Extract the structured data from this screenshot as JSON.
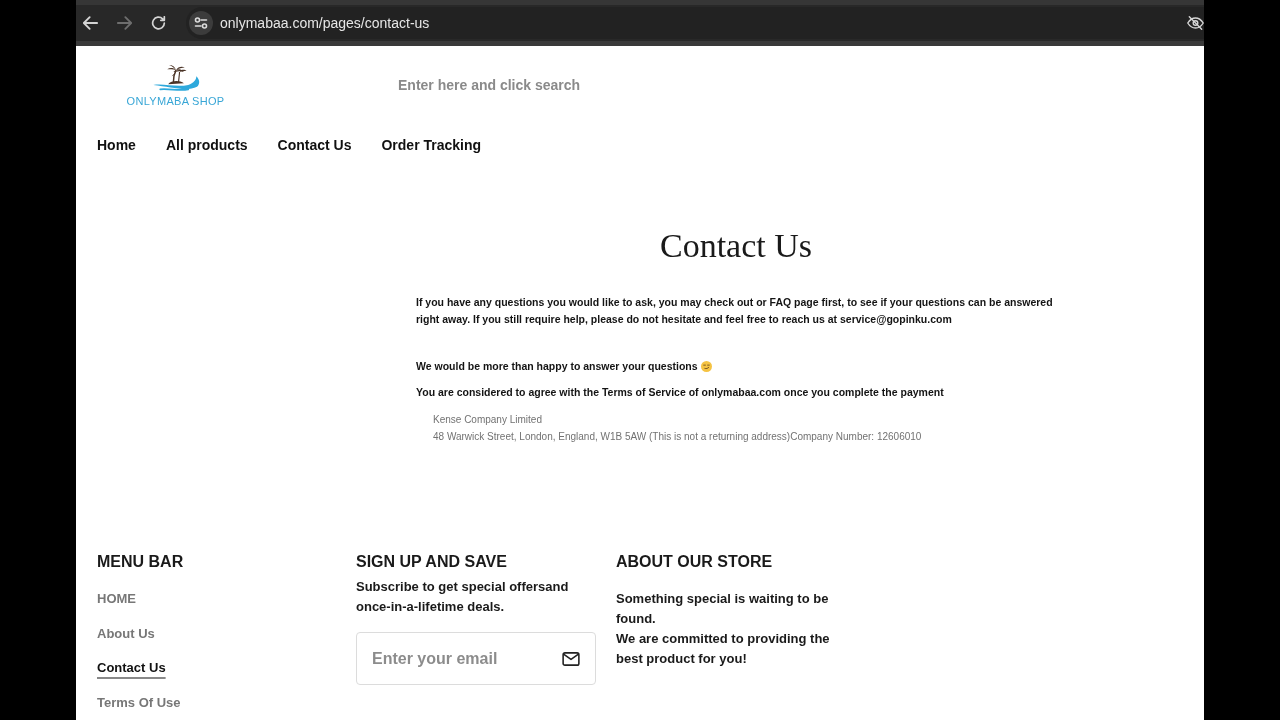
{
  "browser": {
    "nav_buttons": [
      {
        "kind": "back",
        "disabled": false
      },
      {
        "kind": "forward",
        "disabled": true
      },
      {
        "kind": "reload",
        "disabled": false
      }
    ],
    "url": "onlymabaa.com/pages/contact-us"
  },
  "header": {
    "logo_text": "ONLYMABA SHOP",
    "search": {
      "placeholder": "Enter here and click search"
    }
  },
  "nav": [
    "Home",
    "All products",
    "Contact Us",
    "Order Tracking"
  ],
  "main": {
    "title": "Contact Us",
    "intro": "If you have any questions you would like to ask, you may check out or FAQ page first, to see if your questions can be answered right away. If you still require help, please do not hesitate and feel free to reach us at service@gopinku.com",
    "happy": "We would be more than happy to answer your questions",
    "terms": "You are considered to agree with the Terms of Service of onlymabaa.com once you complete the payment",
    "address_lines": [
      "Kense Company Limited",
      "48 Warwick Street, London, England, W1B 5AW (This is not a returning address)Company Number: 12606010"
    ]
  },
  "footer": {
    "menu": {
      "heading": "MENU BAR",
      "links": [
        {
          "label": "HOME",
          "selected": false
        },
        {
          "label": "About Us",
          "selected": false
        },
        {
          "label": "Contact Us",
          "selected": true
        },
        {
          "label": "Terms Of Use",
          "selected": false
        }
      ]
    },
    "signup": {
      "heading": "SIGN UP AND SAVE",
      "text": "Subscribe to get special offersand once-in-a-lifetime deals.",
      "email": {
        "placeholder": "Enter your email"
      }
    },
    "about": {
      "heading": "ABOUT OUR STORE",
      "lines": [
        "Something special is waiting to be found.",
        "We are committed to providing the best product for you!"
      ]
    }
  }
}
